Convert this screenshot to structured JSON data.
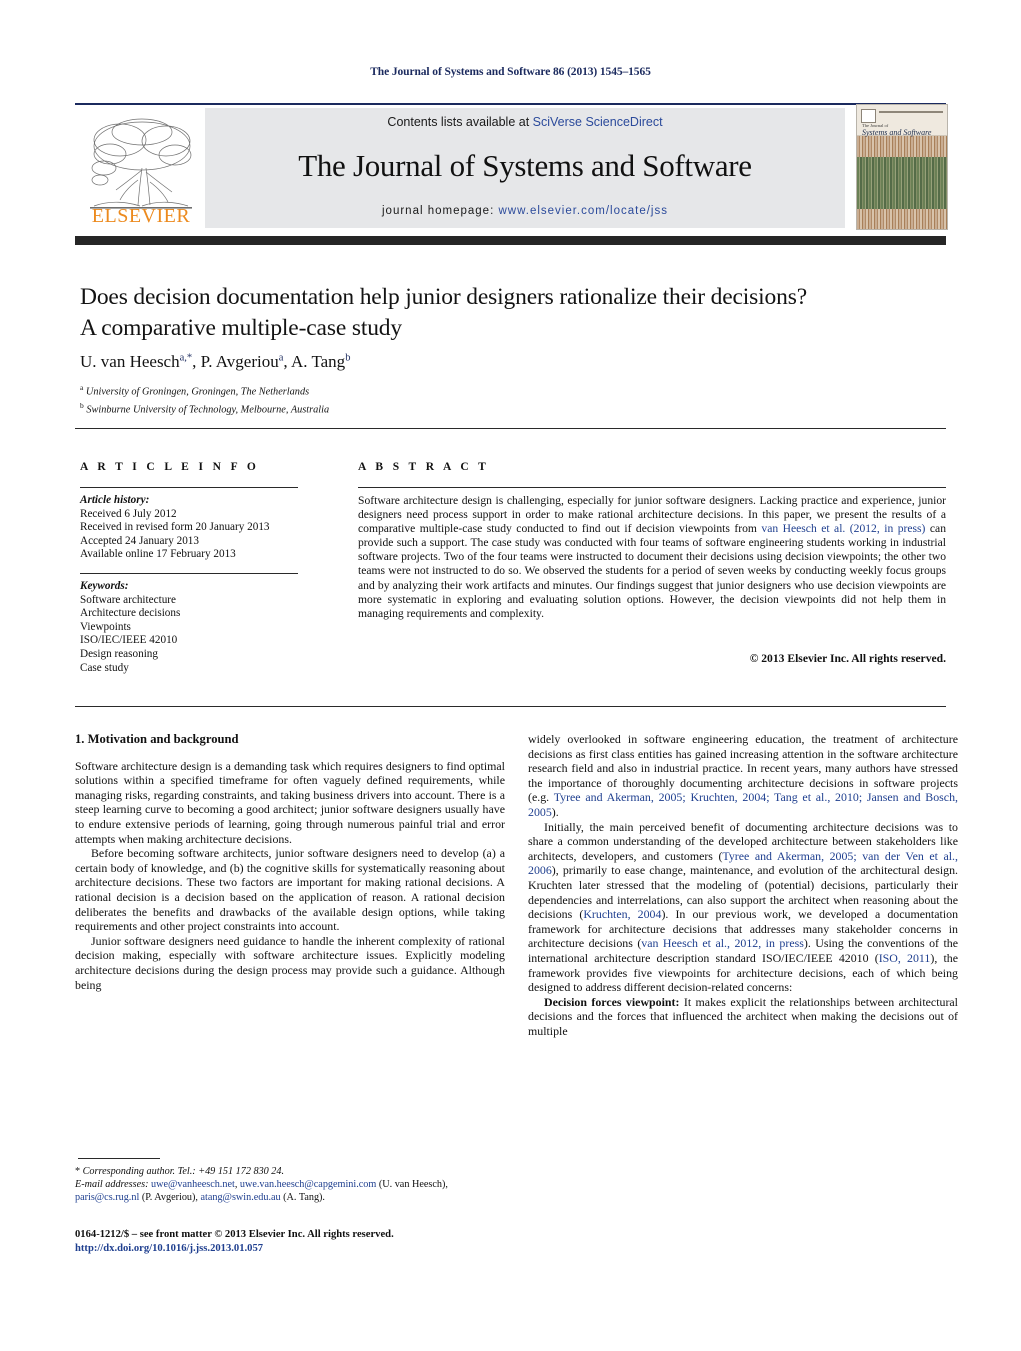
{
  "running_head": "The Journal of Systems and Software 86 (2013) 1545–1565",
  "masthead": {
    "contents_prefix": "Contents lists available at ",
    "contents_link": "SciVerse ScienceDirect",
    "journal_name": "The Journal of Systems and Software",
    "homepage_prefix": "journal homepage: ",
    "homepage_url": "www.elsevier.com/locate/jss",
    "publisher_logo_text": "ELSEVIER",
    "cover_title_small": "The Journal of",
    "cover_title_main": "Systems and Software"
  },
  "article": {
    "title_line1": "Does decision documentation help junior designers rationalize their decisions?",
    "title_line2": "A comparative multiple-case study",
    "authors_html": "U. van Heesch<sup>a,<span class=\"star\">*</span></sup>, P. Avgeriou<sup>a</sup>, A. Tang<sup>b</sup>",
    "affiliation_a": "University of Groningen, Groningen, The Netherlands",
    "affiliation_b": "Swinburne University of Technology, Melbourne, Australia"
  },
  "info": {
    "article_info_label": "A R T I C L E  I N F O",
    "abstract_label": "A B S T R A C T",
    "history_header": "Article history:",
    "history": [
      "Received 6 July 2012",
      "Received in revised form 20 January 2013",
      "Accepted 24 January 2013",
      "Available online 17 February 2013"
    ],
    "keywords_header": "Keywords:",
    "keywords": [
      "Software architecture",
      "Architecture decisions",
      "Viewpoints",
      "ISO/IEC/IEEE 42010",
      "Design reasoning",
      "Case study"
    ]
  },
  "abstract": {
    "text_html": "Software architecture design is challenging, especially for junior software designers. Lacking practice and experience, junior designers need process support in order to make rational architecture decisions. In this paper, we present the results of a comparative multiple-case study conducted to find out if decision viewpoints from <span class=\"ref\">van Heesch et al. (2012, in press)</span> can provide such a support. The case study was conducted with four teams of software engineering students working in industrial software projects. Two of the four teams were instructed to document their decisions using decision viewpoints; the other two teams were not instructed to do so. We observed the students for a period of seven weeks by conducting weekly focus groups and by analyzing their work artifacts and minutes. Our findings suggest that junior designers who use decision viewpoints are more systematic in exploring and evaluating solution options. However, the decision viewpoints did not help them in managing requirements and complexity.",
    "copyright": "© 2013 Elsevier Inc. All rights reserved."
  },
  "body": {
    "section_heading": "1.  Motivation and background",
    "left_paragraphs_html": [
      "Software architecture design is a demanding task which requires designers to find optimal solutions within a specified timeframe for often vaguely defined requirements, while managing risks, regarding constraints, and taking business drivers into account. There is a steep learning curve to becoming a good architect; junior software designers usually have to endure extensive periods of learning, going through numerous painful trial and error attempts when making architecture decisions.",
      "Before becoming software architects, junior software designers need to develop (a) a certain body of knowledge, and (b) the cognitive skills for systematically reasoning about architecture decisions. These two factors are important for making rational decisions. A rational decision is a decision based on the application of reason. A rational decision deliberates the benefits and drawbacks of the available design options, while taking requirements and other project constraints into account.",
      "Junior software designers need guidance to handle the inherent complexity of rational decision making, especially with software architecture issues. Explicitly modeling architecture decisions during the design process may provide such a guidance. Although being"
    ],
    "right_paragraphs_html": [
      "widely overlooked in software engineering education, the treatment of architecture decisions as first class entities has gained increasing attention in the software architecture research field and also in industrial practice. In recent years, many authors have stressed the importance of thoroughly documenting architecture decisions in software projects (e.g. <span class=\"ref\">Tyree and Akerman, 2005; Kruchten, 2004; Tang et al., 2010; Jansen and Bosch, 2005</span>).",
      "Initially, the main perceived benefit of documenting architecture decisions was to share a common understanding of the developed architecture between stakeholders like architects, developers, and customers (<span class=\"ref\">Tyree and Akerman, 2005; van der Ven et al., 2006</span>), primarily to ease change, maintenance, and evolution of the architectural design. Kruchten later stressed that the modeling of (potential) decisions, particularly their dependencies and interrelations, can also support the architect when reasoning about the decisions (<span class=\"ref\">Kruchten, 2004</span>). In our previous work, we developed a documentation framework for architecture decisions that addresses many stakeholder concerns in architecture decisions (<span class=\"ref\">van Heesch et al., 2012, in press</span>). Using the conventions of the international architecture description standard ISO/IEC/IEEE 42010 (<span class=\"ref\">ISO, 2011</span>), the framework provides five viewpoints for architecture decisions, each of which being designed to address different decision-related concerns:",
      "<b>Decision forces viewpoint:</b> It makes explicit the relationships between architectural decisions and the forces that influenced the architect when making the decisions out of multiple"
    ]
  },
  "footnote": {
    "corresponding_html": "* <span class=\"em\">Corresponding author. Tel.: +49 151 172 830 24.</span>",
    "emails_html": "<span class=\"em\">E-mail addresses:</span> <span class=\"mail\">uwe@vanheesch.net</span>, <span class=\"mail\">uwe.van.heesch@capgemini.com</span> (U. van Heesch), <span class=\"mail\">paris@cs.rug.nl</span> (P. Avgeriou), <span class=\"mail\">atang@swin.edu.au</span> (A. Tang).",
    "imprint_line1": "0164-1212/$ – see front matter © 2013 Elsevier Inc. All rights reserved.",
    "imprint_line2": "http://dx.doi.org/10.1016/j.jss.2013.01.057"
  }
}
